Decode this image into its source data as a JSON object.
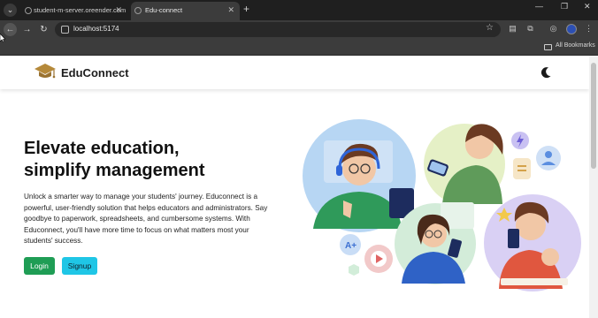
{
  "browser": {
    "tabs": [
      {
        "title": "student-m-server.oreender.com",
        "active": false
      },
      {
        "title": "Edu-connect",
        "active": true
      }
    ],
    "url": "localhost:5174",
    "bookmarks_label": "All Bookmarks"
  },
  "header": {
    "brand": "EduConnect",
    "accent_color": "#b5893a"
  },
  "hero": {
    "title_line1": "Elevate education,",
    "title_line2": "simplify management",
    "description": "Unlock a smarter way to manage your students' journey. Educonnect is a powerful, user-friendly solution that helps educators and administrators. Say goodbye to paperwork, spreadsheets, and cumbersome systems. With Educonnect, you'll have more time to focus on what matters most your students' success.",
    "login_label": "Login",
    "signup_label": "Signup",
    "login_color": "#1f9d55",
    "signup_color": "#1fc6e6"
  },
  "icons": {
    "theme_toggle": "moon-icon",
    "logo": "graduation-cap-icon"
  }
}
